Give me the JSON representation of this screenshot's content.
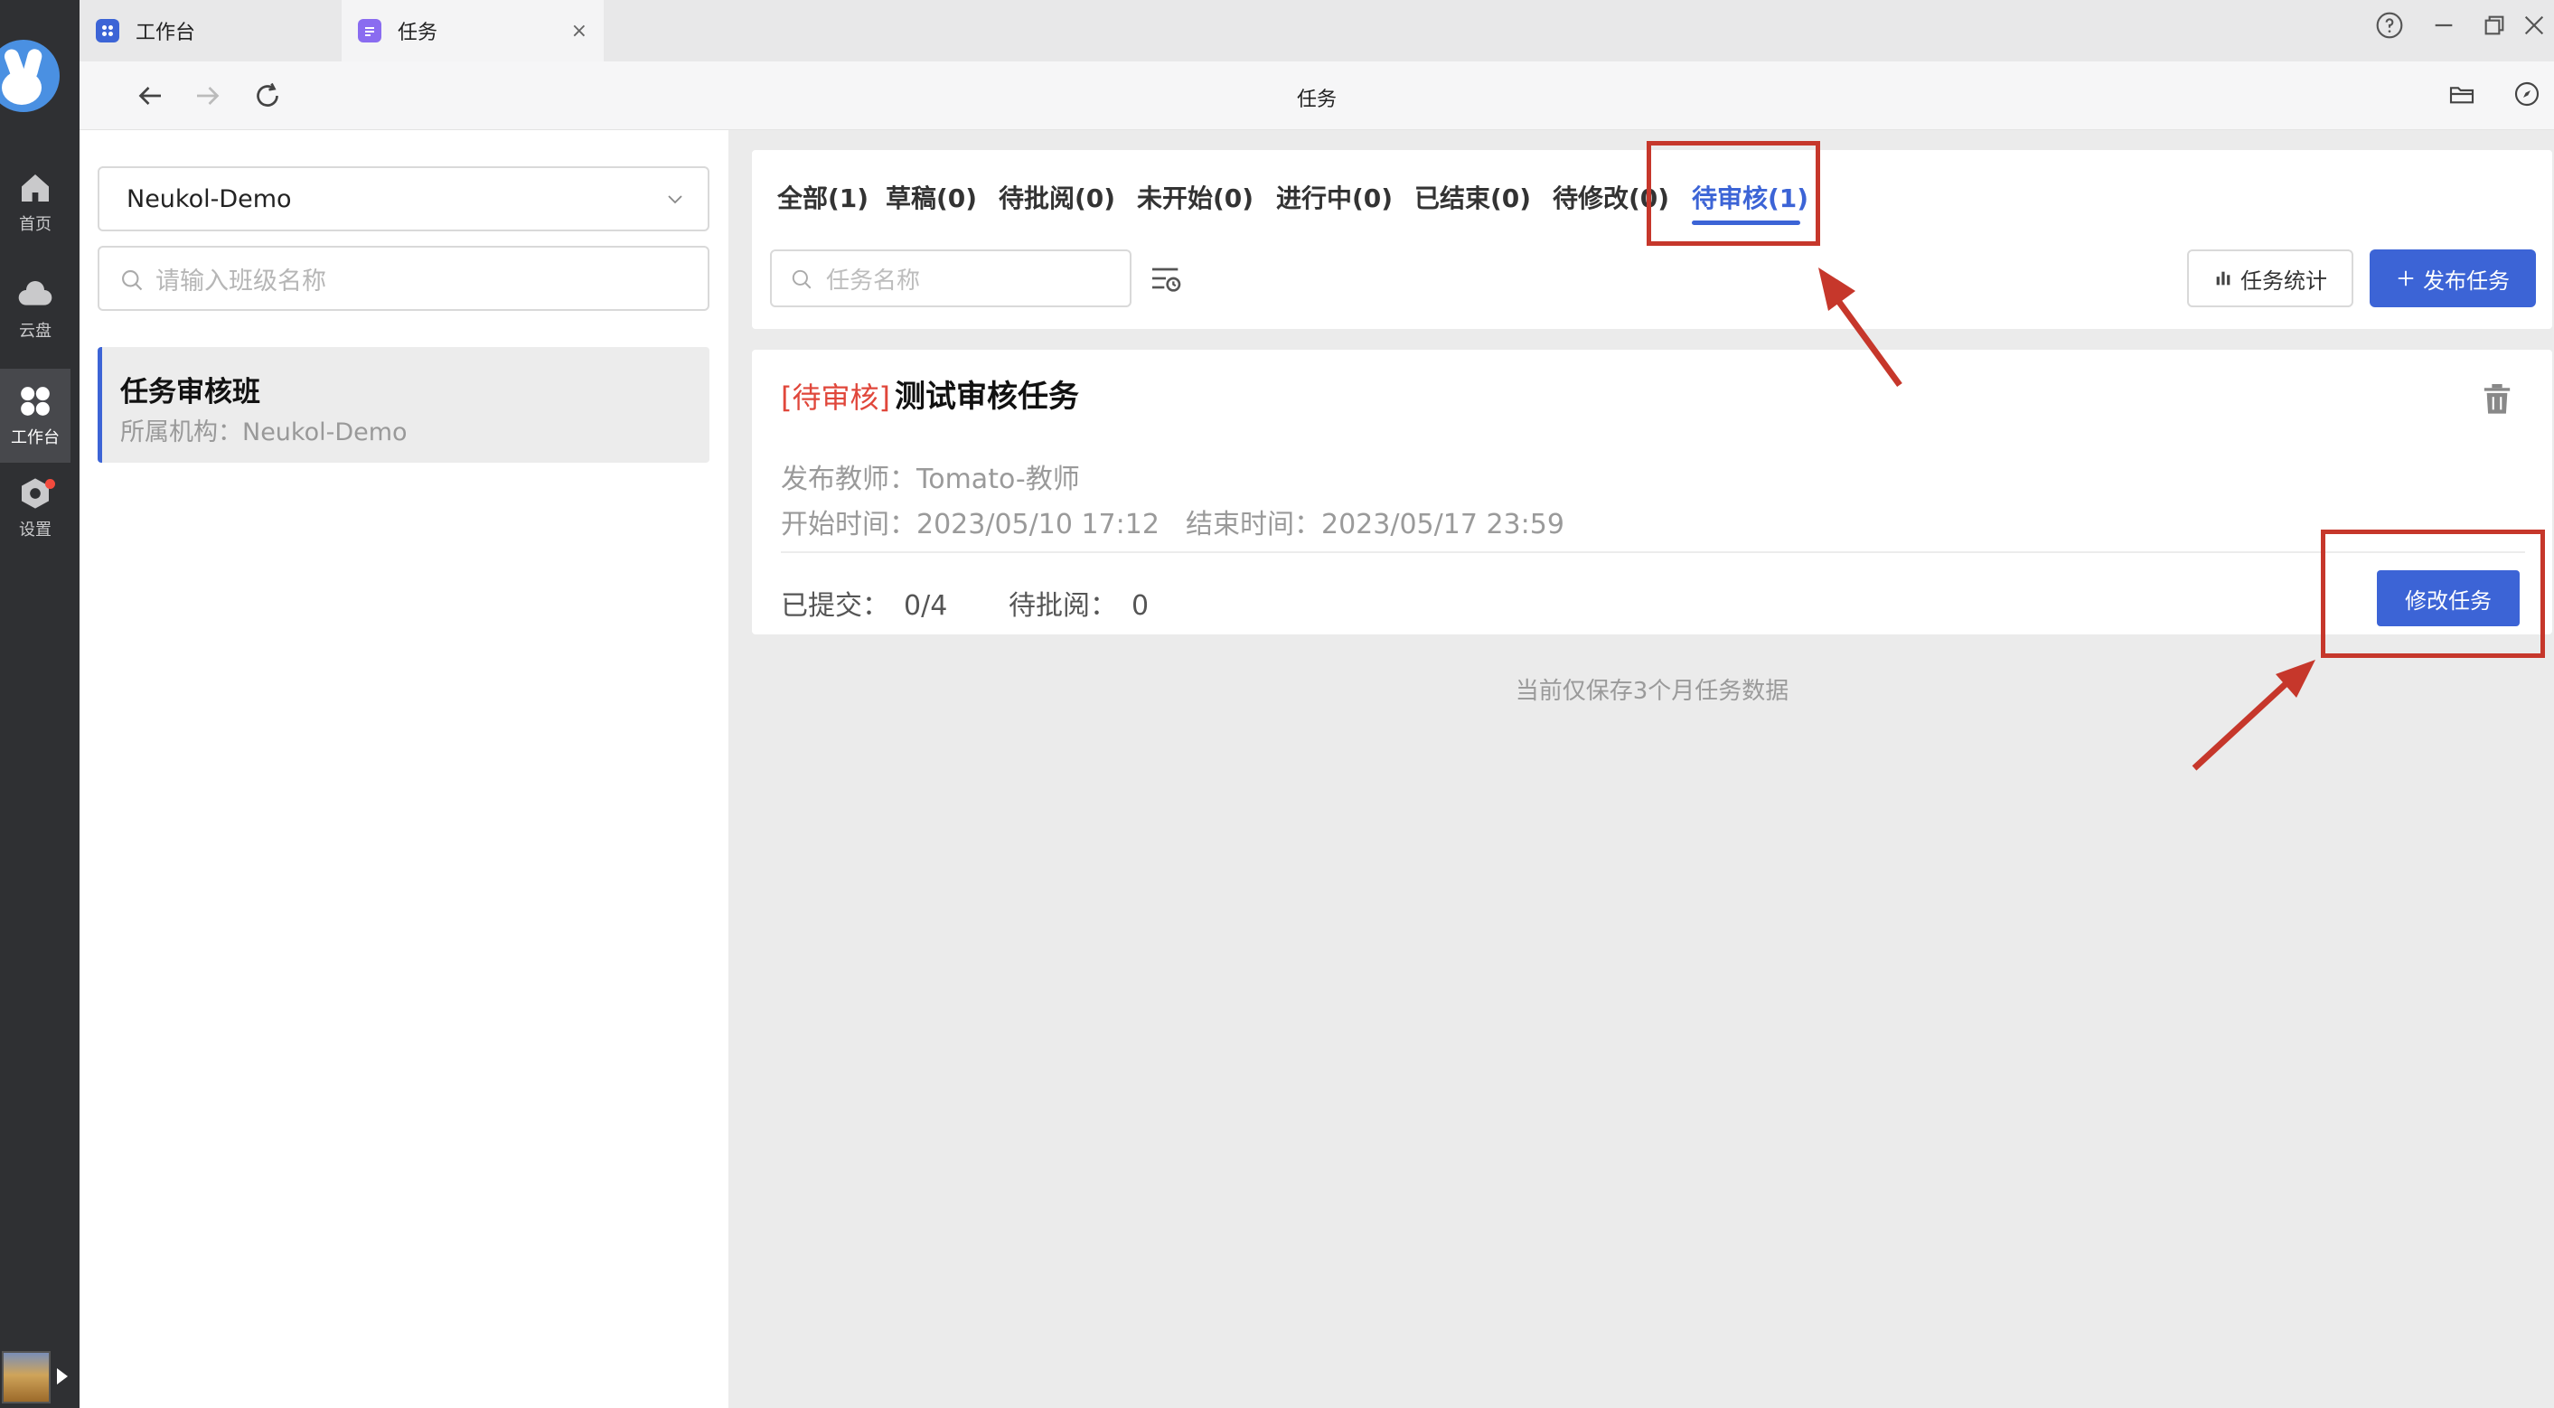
{
  "rail": {
    "items": [
      {
        "label": "首页",
        "icon": "home-icon"
      },
      {
        "label": "云盘",
        "icon": "cloud-icon"
      },
      {
        "label": "工作台",
        "icon": "grid-icon"
      },
      {
        "label": "设置",
        "icon": "settings-icon"
      }
    ]
  },
  "tabs": [
    {
      "label": "工作台",
      "icon": "grid-icon",
      "color": "#3c64d6"
    },
    {
      "label": "任务",
      "icon": "task-list-icon",
      "color": "#8a6cf0",
      "close": "×"
    }
  ],
  "nav": {
    "title": "任务"
  },
  "left": {
    "org_select": "Neukol-Demo",
    "class_search_placeholder": "请输入班级名称",
    "class_item": {
      "name": "任务审核班",
      "org_label": "所属机构：",
      "org_value": "Neukol-Demo"
    }
  },
  "filters": {
    "tabs": [
      "全部(1)",
      "草稿(0)",
      "待批阅(0)",
      "未开始(0)",
      "进行中(0)",
      "已结束(0)",
      "待修改(0)",
      "待审核(1)"
    ],
    "active_index": 7,
    "search_placeholder": "任务名称",
    "stat_button": "任务统计",
    "publish_button": "发布任务"
  },
  "task": {
    "status": "[待审核]",
    "title": "测试审核任务",
    "teacher_label": "发布教师：",
    "teacher": "Tomato-教师",
    "start_label": "开始时间：",
    "start": "2023/05/10 17:12",
    "end_label": "结束时间：",
    "end": "2023/05/17 23:59",
    "submitted_label": "已提交：",
    "submitted": "0/4",
    "pending_label": "待批阅：",
    "pending": "0",
    "edit_button": "修改任务"
  },
  "note": "当前仅保存3个月任务数据",
  "colors": {
    "accent": "#3c64d6",
    "status": "#e0473b",
    "annotation": "#c6372b"
  }
}
